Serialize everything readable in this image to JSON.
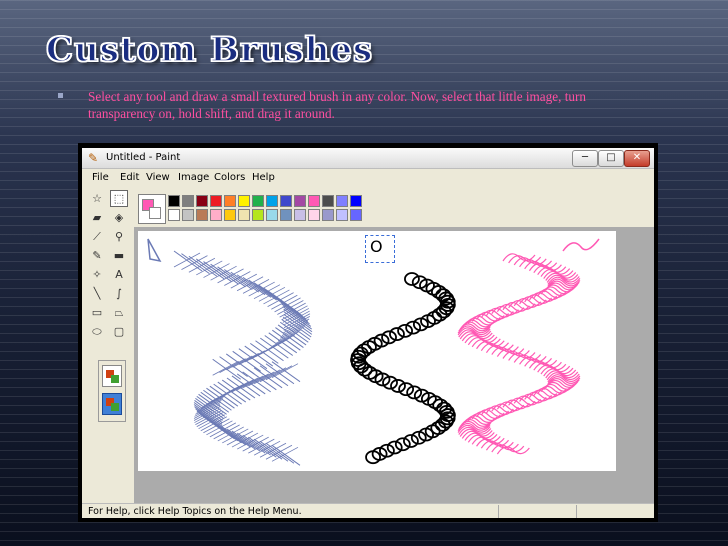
{
  "slide": {
    "title": "Custom Brushes",
    "bullet": "Select any tool and draw a small textured brush in any color. Now, select that little image, turn transparency on, hold shift, and drag it around."
  },
  "window": {
    "title": "Untitled - Paint",
    "min_label": "─",
    "max_label": "□",
    "close_label": "✕"
  },
  "menu": [
    "File",
    "Edit",
    "View",
    "Image",
    "Colors",
    "Help"
  ],
  "tools": [
    {
      "name": "free-select-icon",
      "glyph": "☆"
    },
    {
      "name": "rect-select-icon",
      "glyph": "⬚"
    },
    {
      "name": "eraser-icon",
      "glyph": "▰"
    },
    {
      "name": "fill-bucket-icon",
      "glyph": "◈"
    },
    {
      "name": "eyedropper-icon",
      "glyph": "⟋"
    },
    {
      "name": "magnifier-icon",
      "glyph": "⚲"
    },
    {
      "name": "pencil-icon",
      "glyph": "✎"
    },
    {
      "name": "brush-icon",
      "glyph": "▬"
    },
    {
      "name": "airbrush-icon",
      "glyph": "✧"
    },
    {
      "name": "text-icon",
      "glyph": "A"
    },
    {
      "name": "line-icon",
      "glyph": "╲"
    },
    {
      "name": "curve-icon",
      "glyph": "∫"
    },
    {
      "name": "rectangle-icon",
      "glyph": "▭"
    },
    {
      "name": "polygon-icon",
      "glyph": "⏢"
    },
    {
      "name": "ellipse-icon",
      "glyph": "⬭"
    },
    {
      "name": "rounded-rect-icon",
      "glyph": "▢"
    }
  ],
  "palette": {
    "foreground": "#ff59b4",
    "background": "#ffffff",
    "colors_top": [
      "#000000",
      "#7f7f7f",
      "#880015",
      "#ed1c24",
      "#ff7f27",
      "#fff200",
      "#22b14c",
      "#00a2e8",
      "#3f48cc",
      "#a349a4",
      "#ff59b4",
      "#4d4d4d",
      "#8080ff",
      "#0000ff"
    ],
    "colors_bottom": [
      "#ffffff",
      "#c3c3c3",
      "#b97a57",
      "#ffaec9",
      "#ffc90e",
      "#efe4b0",
      "#b5e61d",
      "#99d9ea",
      "#7092be",
      "#c8bfe7",
      "#ffd5ea",
      "#9999cc",
      "#c0c0ff",
      "#6666ff"
    ]
  },
  "brush_colors": {
    "blue": "#6b7ab5",
    "black": "#000000",
    "pink": "#ff59b4"
  },
  "selection_glyph": "O",
  "status": {
    "help_text": "For Help, click Help Topics on the Help Menu."
  }
}
